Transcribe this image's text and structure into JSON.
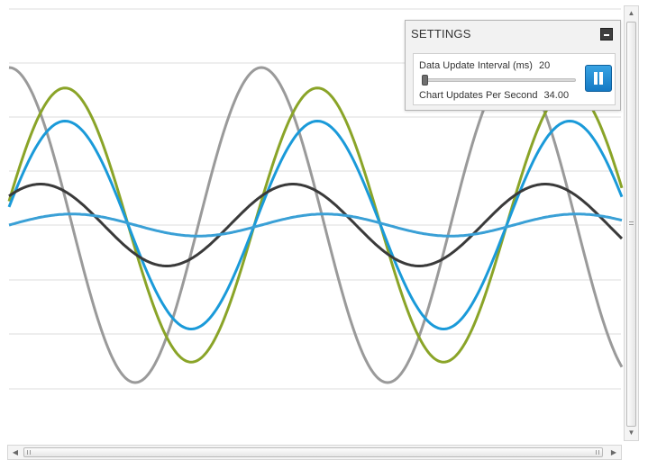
{
  "settings": {
    "title": "SETTINGS",
    "interval_label": "Data Update Interval (ms)",
    "interval_value": "20",
    "interval_slider_fraction": 0.0,
    "rate_label": "Chart Updates Per Second",
    "rate_value": "34.00"
  },
  "icons": {
    "minimize": "minimize-icon",
    "pause": "pause-icon",
    "scroll_up": "chevron-up-icon",
    "scroll_down": "chevron-down-icon",
    "scroll_left": "chevron-left-icon",
    "scroll_right": "chevron-right-icon"
  },
  "colors": {
    "accent": "#1c8ad6",
    "gridline": "#dcdcdc"
  },
  "chart_data": {
    "type": "line",
    "title": "",
    "xlabel": "",
    "ylabel": "",
    "grid": "horizontal",
    "x_range": [
      0,
      680
    ],
    "y_range": [
      -1.2,
      1.2
    ],
    "series": [
      {
        "color": "#9a9a9a",
        "amplitude": 1.0,
        "phase_deg": 90,
        "period": 280,
        "offset": 0.0
      },
      {
        "color": "#8aa428",
        "amplitude": 0.87,
        "phase_deg": 10,
        "period": 280,
        "offset": 0.0
      },
      {
        "color": "#1a9ad9",
        "amplitude": 0.66,
        "phase_deg": 10,
        "period": 280,
        "offset": 0.0
      },
      {
        "color": "#3a3a3a",
        "amplitude": 0.26,
        "phase_deg": 45,
        "period": 280,
        "offset": 0.0
      },
      {
        "color": "#3aa0d6",
        "amplitude": 0.07,
        "phase_deg": 0,
        "period": 280,
        "offset": 0.0
      }
    ]
  }
}
